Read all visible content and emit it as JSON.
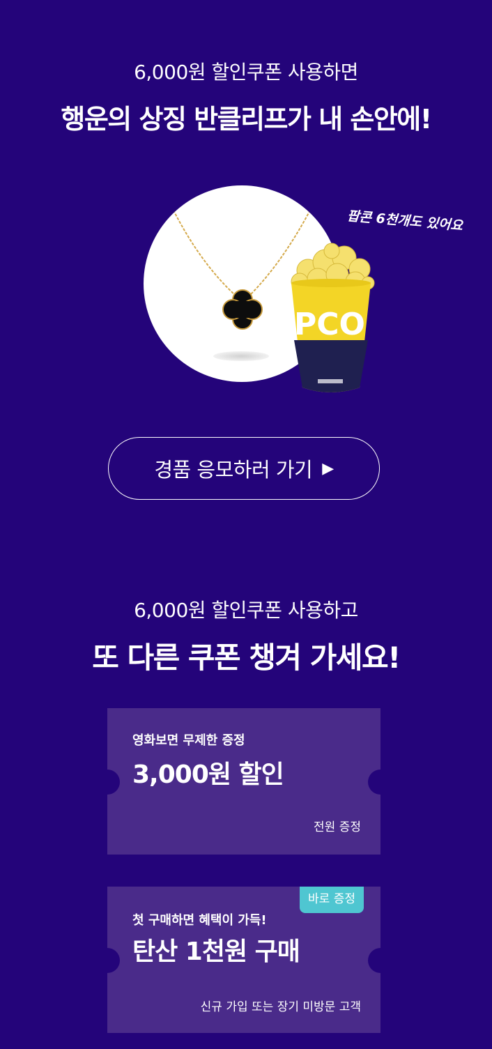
{
  "section1": {
    "subtitle": "6,000원 할인쿠폰 사용하면",
    "headline": "행운의 상징 반클리프가 내 손안에!",
    "popcorn_note": "팝콘 6천개도 있어요",
    "popcorn_label": "PCO",
    "cta_label": "경품 응모하러 가기",
    "cta_arrow_icon": "play-arrow-icon"
  },
  "section2": {
    "subtitle": "6,000원 할인쿠폰 사용하고",
    "headline": "또 다른 쿠폰 챙겨 가세요!",
    "coupons": [
      {
        "small": "영화보면 무제한 증정",
        "big": "3,000원 할인",
        "note": "전원 증정"
      },
      {
        "badge": "바로 증정",
        "small": "첫 구매하면 혜택이 가득!",
        "big": "탄산 1천원 구매",
        "note": "신규 가입 또는 장기 미방문 고객"
      }
    ]
  },
  "colors": {
    "background": "#24047a",
    "coupon": "#4a2b8a",
    "badge": "#4fc6d1",
    "popcorn_cup_yellow": "#f3d526",
    "popcorn_cup_navy": "#1f2050"
  }
}
